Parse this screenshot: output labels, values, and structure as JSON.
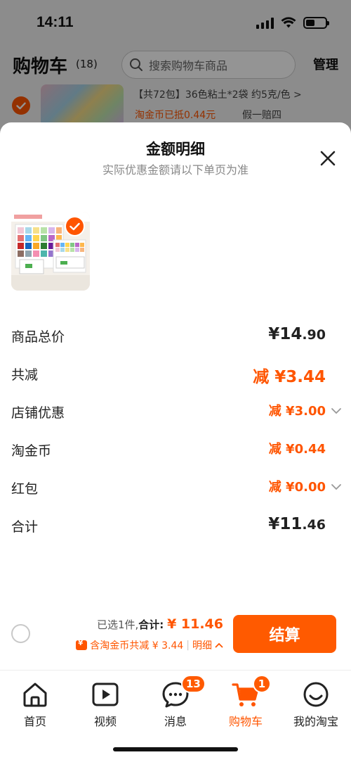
{
  "status": {
    "time": "14:11"
  },
  "background_page": {
    "title": "购物车",
    "count": "(18)",
    "search_placeholder": "搜索购物车商品",
    "manage": "管理",
    "item": {
      "title": "【共72包】36色粘土*2袋 约5克/色 >",
      "coin_text": "淘金币已抵0.44元",
      "guarantee": "假一赔四"
    }
  },
  "sheet": {
    "title": "金额明细",
    "subtitle": "实际优惠金额请以下单页为准",
    "rows": [
      {
        "label": "商品总价",
        "prefix": "¥",
        "value": "14",
        "decimal": ".90"
      },
      {
        "label": "共减",
        "prefix": "减 ¥",
        "value": "3.44",
        "decimal": ""
      },
      {
        "label": "店铺优惠",
        "prefix": "减 ¥",
        "value": "3.00",
        "decimal": ""
      },
      {
        "label": "淘金币",
        "prefix": "减 ¥",
        "value": "0.44",
        "decimal": ""
      },
      {
        "label": "红包",
        "prefix": "减 ¥",
        "value": "0.00",
        "decimal": ""
      },
      {
        "label": "合计",
        "prefix": "¥",
        "value": "11",
        "decimal": ".46"
      }
    ]
  },
  "checkout": {
    "selected_prefix": "已选1件,",
    "total_label": "合计:",
    "total_value": "¥ 11.46",
    "discount_text": "含淘金币共减 ¥ 3.44",
    "detail_sep": "|",
    "detail_label": "明细",
    "button": "结算"
  },
  "tabbar": {
    "items": [
      {
        "label": "首页",
        "icon": "home-icon"
      },
      {
        "label": "视频",
        "icon": "video-play-icon"
      },
      {
        "label": "消息",
        "icon": "message-icon",
        "badge": "13"
      },
      {
        "label": "购物车",
        "icon": "cart-icon",
        "badge": "1"
      },
      {
        "label": "我的淘宝",
        "icon": "smile-face-icon"
      }
    ]
  },
  "colors": {
    "accent": "#ff5500",
    "button": "#ff5a00"
  }
}
